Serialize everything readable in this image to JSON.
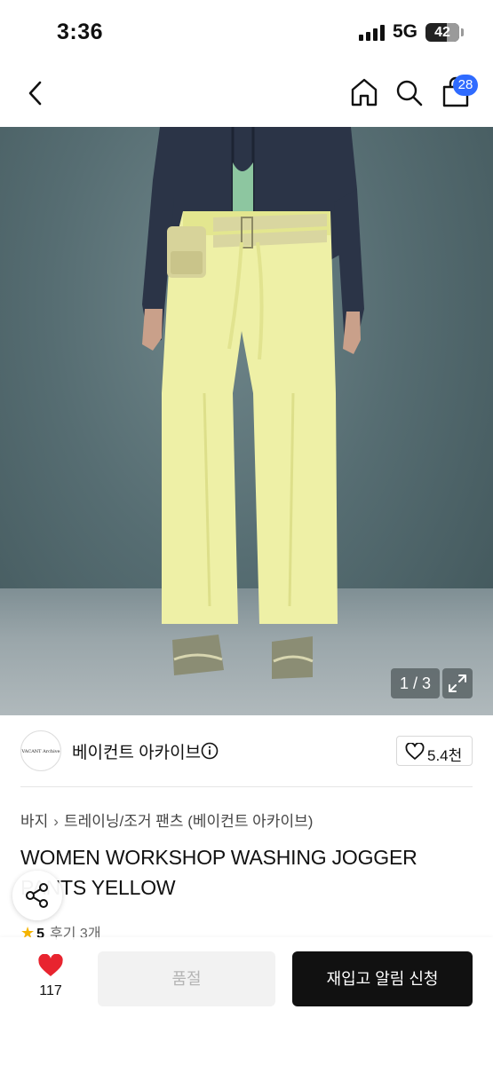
{
  "status_bar": {
    "time": "3:36",
    "network": "5G",
    "battery": "42"
  },
  "nav": {
    "cart_count": "28",
    "icons": [
      "back-arrow-icon",
      "home-icon",
      "search-icon",
      "shopping-bag-icon"
    ]
  },
  "gallery": {
    "counter": "1 / 3"
  },
  "brand": {
    "logo_text": "VACANT Archive",
    "name": "베이컨트 아카이브",
    "likes": "5.4천"
  },
  "breadcrumb": [
    "바지",
    "트레이닝/조거 팬츠 (베이컨트 아카이브)"
  ],
  "product": {
    "title": "WOMEN WORKSHOP WASHING JOGGER PANTS YELLOW",
    "rating": "5",
    "reviews": "후기 3개"
  },
  "actions": {
    "wish_count": "117",
    "soldout_label": "품절",
    "restock_label": "재입고 알림 신청"
  },
  "colors": {
    "accent": "#2f6bff",
    "primary_button": "#111111",
    "heart": "#e8242f",
    "star": "#f5b400"
  }
}
